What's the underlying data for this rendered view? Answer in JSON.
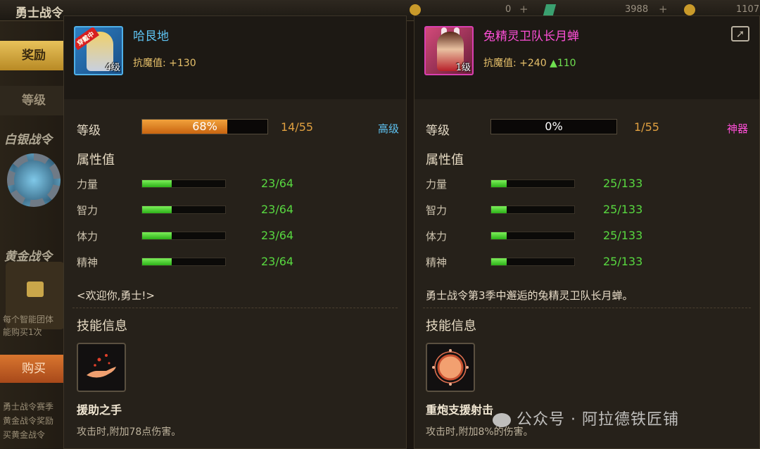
{
  "background": {
    "title": "勇士战令",
    "currency1": "0",
    "currency2": "3988",
    "currency3": "1107",
    "tab_active": "奖励",
    "tab_normal": "等级",
    "label_silver": "白银战令",
    "label_gold": "黄金战令",
    "lock_text_1": "每个智能团体",
    "lock_text_2": "能购买1次",
    "buy_label": "购买",
    "footer_1": "勇士战令赛季",
    "footer_2": "黄金战令奖励",
    "footer_3": "买黄金战令"
  },
  "left": {
    "item_name": "哈艮地",
    "avatar_level": "4级",
    "avatar_tag": "穿戴中",
    "resist_label": "抗魔值: +130",
    "level_label": "等级",
    "level_percent": "68%",
    "level_fraction": 0.68,
    "level_progress": "14/55",
    "grade": "高级",
    "attr_title": "属性值",
    "stats": [
      {
        "name": "力量",
        "value": "23/64",
        "fraction": 0.359
      },
      {
        "name": "智力",
        "value": "23/64",
        "fraction": 0.359
      },
      {
        "name": "体力",
        "value": "23/64",
        "fraction": 0.359
      },
      {
        "name": "精神",
        "value": "23/64",
        "fraction": 0.359
      }
    ],
    "description": "<欢迎你,勇士!>",
    "skill_title": "技能信息",
    "skill_name": "援助之手",
    "skill_desc": "攻击时,附加78点伤害。"
  },
  "right": {
    "item_name": "兔精灵卫队长月蝉",
    "avatar_level": "1级",
    "resist_label": "抗魔值: +240",
    "resist_bonus": "▲110",
    "level_label": "等级",
    "level_percent": "0%",
    "level_fraction": 0.0,
    "level_progress": "1/55",
    "grade": "神器",
    "attr_title": "属性值",
    "stats": [
      {
        "name": "力量",
        "value": "25/133",
        "fraction": 0.188
      },
      {
        "name": "智力",
        "value": "25/133",
        "fraction": 0.188
      },
      {
        "name": "体力",
        "value": "25/133",
        "fraction": 0.188
      },
      {
        "name": "精神",
        "value": "25/133",
        "fraction": 0.188
      }
    ],
    "description": "勇士战令第3季中邂逅的兔精灵卫队长月蝉。",
    "skill_title": "技能信息",
    "skill_name": "重炮支援射击",
    "skill_desc": "攻击时,附加8%的伤害。"
  },
  "watermark": "公众号 · 阿拉德铁匠铺",
  "colors": {
    "level_fill": "#e88a20",
    "stat_fill": "#4fd830",
    "grade_high": "#5ec3f2",
    "grade_artifact": "#ff4fd8"
  }
}
